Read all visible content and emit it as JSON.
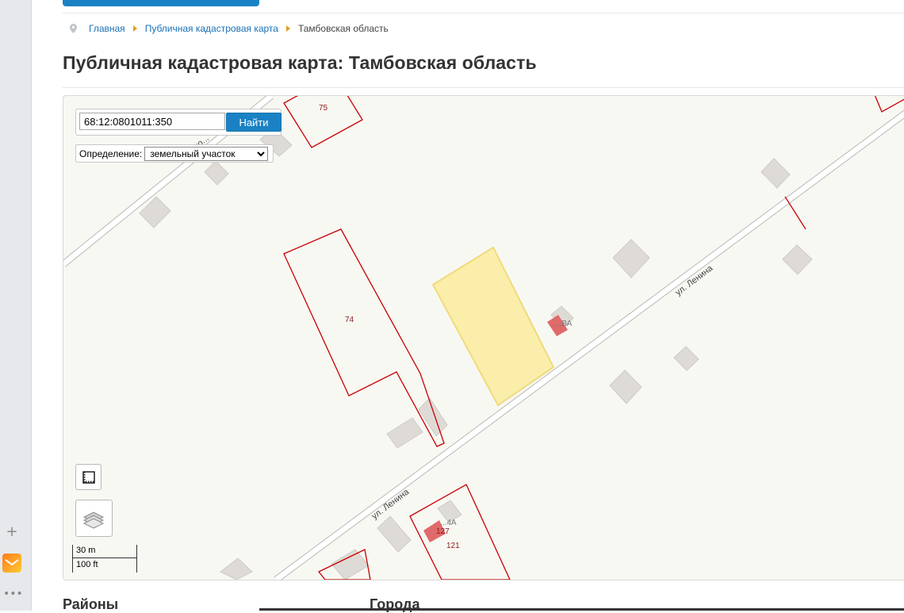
{
  "breadcrumb": {
    "home": "Главная",
    "map": "Публичная кадастровая карта",
    "current": "Тамбовская область"
  },
  "page_title": "Публичная кадастровая карта: Тамбовская область",
  "search": {
    "value": "68:12:0801011:350",
    "button": "Найти"
  },
  "definition": {
    "label": "Определение:",
    "selected": "земельный участок"
  },
  "map": {
    "street_upper": "ул. Ленина",
    "street_lower": "ул. Ленина",
    "street_partial": "...омсо...",
    "parcel_labels": [
      "75",
      "74",
      "121"
    ],
    "building_labels": [
      "...ВА",
      "...4А",
      "127"
    ],
    "highlight_color": "#fbeeaa",
    "parcel_border_color": "#c80000"
  },
  "scale": {
    "metric": "30 m",
    "imperial": "100 ft"
  },
  "sections": {
    "districts": "Районы",
    "cities": "Города"
  }
}
